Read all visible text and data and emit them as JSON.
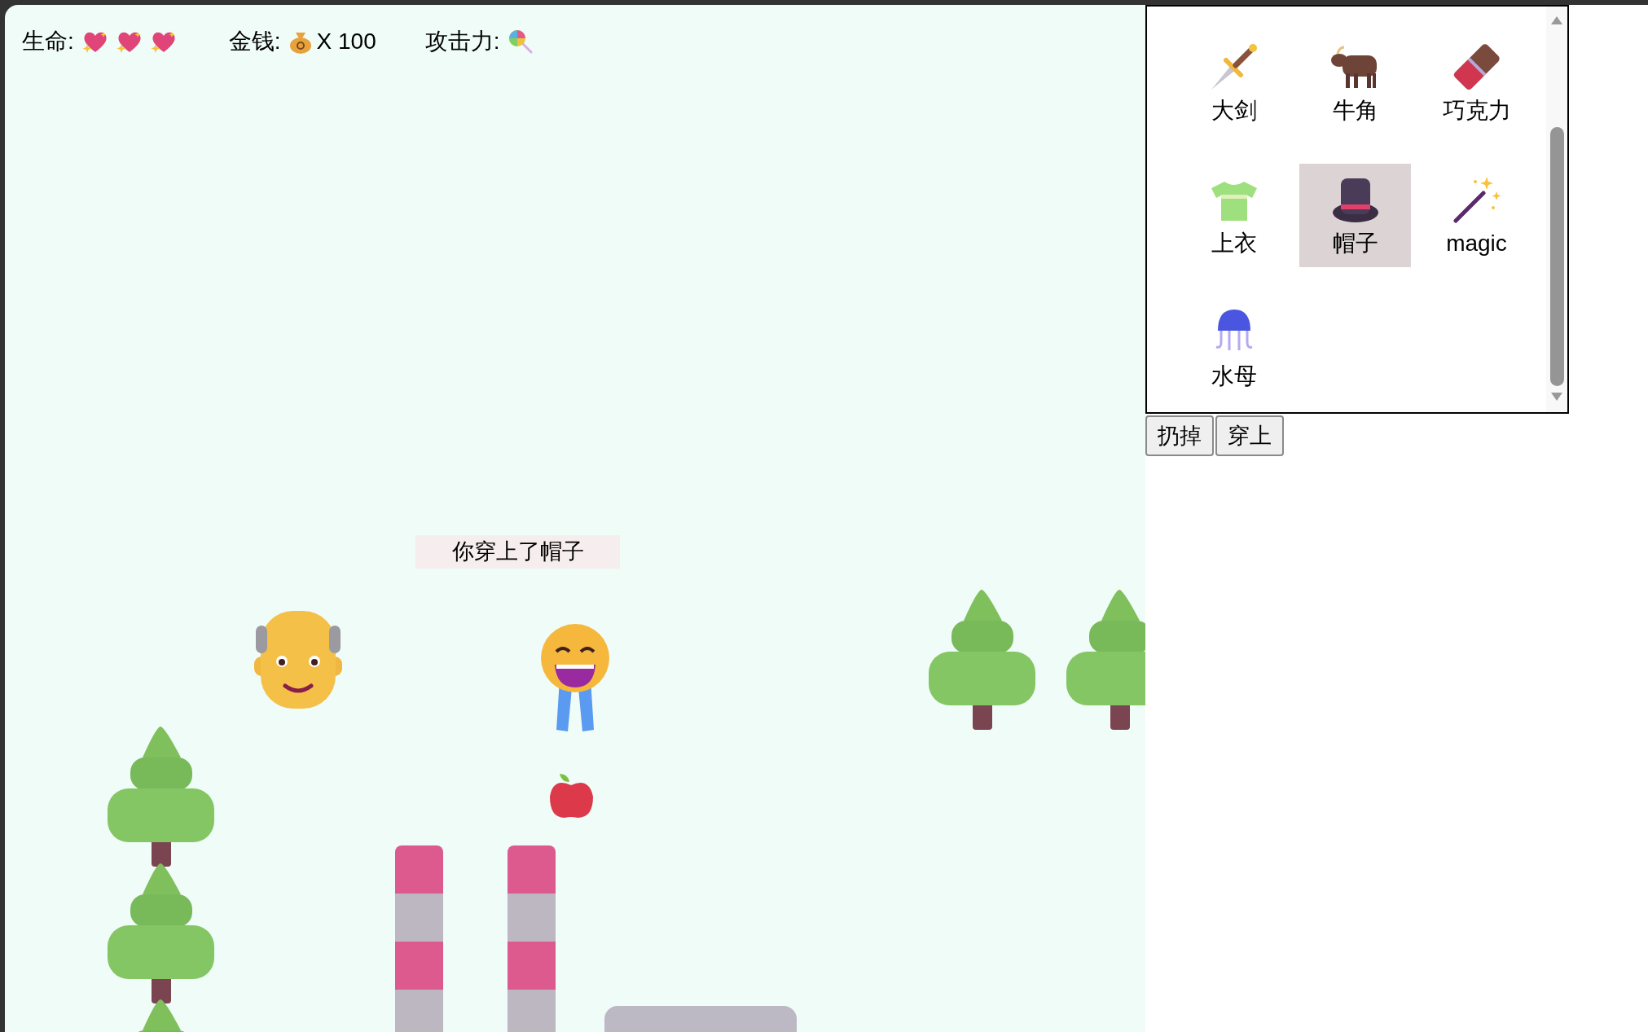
{
  "hud": {
    "lives_label": "生命:",
    "money_label": "金钱:",
    "money_value": "X 100",
    "attack_label": "攻击力:"
  },
  "message": "你穿上了帽子",
  "inventory": {
    "items": [
      {
        "label": "大剑",
        "kind": "dagger",
        "selected": false
      },
      {
        "label": "牛角",
        "kind": "ox",
        "selected": false
      },
      {
        "label": "巧克力",
        "kind": "chocolate",
        "selected": false
      },
      {
        "label": "上衣",
        "kind": "shirt",
        "selected": false
      },
      {
        "label": "帽子",
        "kind": "hat",
        "selected": true
      },
      {
        "label": "magic",
        "kind": "wand",
        "selected": false
      },
      {
        "label": "水母",
        "kind": "jellyfish",
        "selected": false
      }
    ]
  },
  "buttons": [
    "扔掉",
    "穿上"
  ]
}
